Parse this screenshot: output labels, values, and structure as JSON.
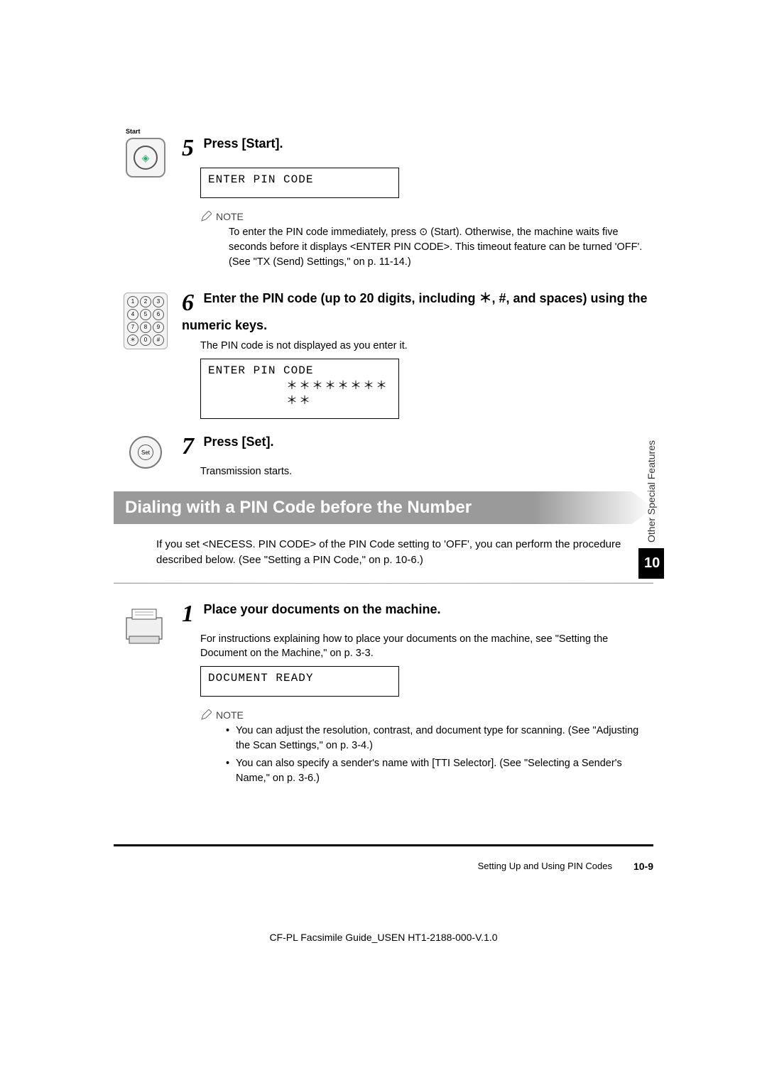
{
  "step5": {
    "num": "5",
    "title": "Press [Start].",
    "lcd": "ENTER PIN CODE",
    "note_label": "NOTE",
    "note_text": "To enter the PIN code immediately, press ⊙ (Start). Otherwise, the machine waits five seconds before it displays <ENTER PIN CODE>. This timeout feature can be turned 'OFF'. (See \"TX (Send) Settings,\" on p. 11-14.)"
  },
  "step6": {
    "num": "6",
    "title": "Enter the PIN code (up to 20 digits, including ＊, #, and spaces) using the numeric keys.",
    "body": "The PIN code is not displayed as you enter it.",
    "lcd_line1": "ENTER PIN CODE",
    "lcd_line2": "＊＊＊＊＊＊＊＊＊＊"
  },
  "step7": {
    "num": "7",
    "title": "Press [Set].",
    "body": "Transmission starts."
  },
  "section": {
    "heading": "Dialing with a PIN Code before the Number",
    "intro": "If you set <NECESS. PIN CODE> of the PIN Code setting to 'OFF', you can perform the procedure described below. (See \"Setting a PIN Code,\" on p. 10-6.)"
  },
  "step1": {
    "num": "1",
    "title": "Place your documents on the machine.",
    "body": "For instructions explaining how to place your documents on the machine, see \"Setting the Document on the Machine,\" on p. 3-3.",
    "lcd": "DOCUMENT READY",
    "note_label": "NOTE",
    "bullet1": "You can adjust the resolution, contrast, and document type for scanning. (See \"Adjusting the Scan Settings,\" on p. 3-4.)",
    "bullet2": "You can also specify a sender's name with [TTI Selector]. (See \"Selecting a Sender's Name,\" on p. 3-6.)"
  },
  "side": {
    "text": "Other Special Features",
    "num": "10"
  },
  "footer": {
    "section": "Setting Up and Using PIN Codes",
    "page": "10-9",
    "doc": "CF-PL Facsimile Guide_USEN HT1-2188-000-V.1.0"
  },
  "icons": {
    "start_label": "Start",
    "set_label": "Set",
    "start_glyph": "◈"
  }
}
